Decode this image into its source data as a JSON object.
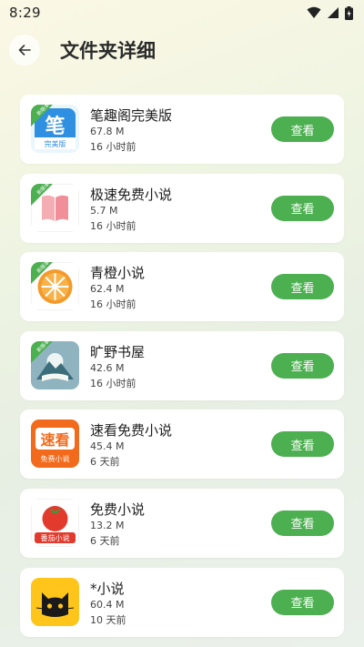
{
  "status_bar": {
    "time": "8:29",
    "icons": [
      "wifi-icon",
      "signal-icon",
      "battery-icon"
    ]
  },
  "header": {
    "back_icon": "arrow-left-icon",
    "title": "文件夹详细"
  },
  "colors": {
    "accent": "#4caf50",
    "card_bg": "#ffffff",
    "badge": "#4caf50"
  },
  "apps": [
    {
      "name": "笔趣阁完美版",
      "size": "67.8 M",
      "time": "16 小时前",
      "button": "查看",
      "badge": "新版本",
      "icon_text": "笔",
      "icon_subtext": "完美版"
    },
    {
      "name": "极速免费小说",
      "size": "5.7 M",
      "time": "16 小时前",
      "button": "查看",
      "badge": "新版本"
    },
    {
      "name": "青橙小说",
      "size": "62.4 M",
      "time": "16 小时前",
      "button": "查看",
      "badge": "新版本"
    },
    {
      "name": "旷野书屋",
      "size": "42.6 M",
      "time": "16 小时前",
      "button": "查看",
      "badge": "新版本"
    },
    {
      "name": "速看免费小说",
      "size": "45.4 M",
      "time": "6 天前",
      "button": "查看",
      "icon_text": "速看",
      "icon_subtext": "免费小说"
    },
    {
      "name": "免费小说",
      "size": "13.2 M",
      "time": "6 天前",
      "button": "查看",
      "icon_subtext": "番茄小说"
    },
    {
      "name": "*小说",
      "size": "60.4 M",
      "time": "10 天前",
      "button": "查看"
    }
  ]
}
